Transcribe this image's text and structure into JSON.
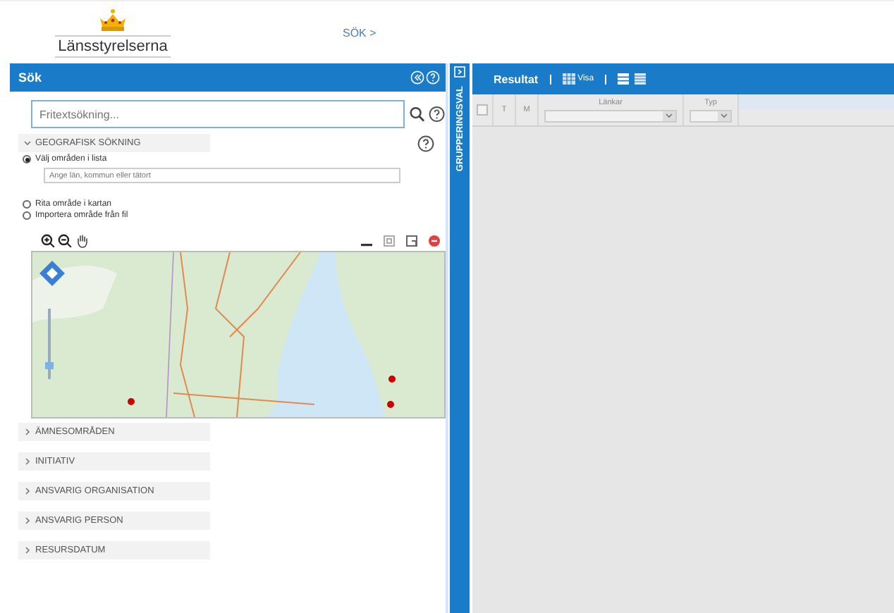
{
  "header": {
    "logo_text": "Länsstyrelserna",
    "nav_link": "SÖK >"
  },
  "search_panel": {
    "title": "Sök",
    "search_field": {
      "placeholder": "Fritextsökning..."
    },
    "geo_section": {
      "title": "GEOGRAFISK SÖKNING",
      "expanded": true,
      "options": [
        {
          "label": "Välj områden i lista",
          "selected": true,
          "field_placeholder": "Ange län, kommun eller tätort"
        },
        {
          "label": "Rita område i kartan",
          "selected": false
        },
        {
          "label": "Importera område från fil",
          "selected": false
        }
      ]
    },
    "sections": [
      {
        "title": "ÄMNESOMRÅDEN",
        "expanded": false
      },
      {
        "title": "INITIATIV",
        "expanded": false
      },
      {
        "title": "ANSVARIG ORGANISATION",
        "expanded": false
      },
      {
        "title": "ANSVARIG PERSON",
        "expanded": false
      },
      {
        "title": "RESURSDATUM",
        "expanded": false
      }
    ]
  },
  "grouping_tab": {
    "label": "GRUPPERINGSVAL"
  },
  "results": {
    "title": "Resultat",
    "view_menu": "Visa",
    "select_all_checked": false,
    "columns": [
      {
        "label": "T",
        "kind": "plain"
      },
      {
        "label": "M",
        "kind": "plain"
      },
      {
        "label": "Länkar",
        "kind": "filter"
      },
      {
        "label": "Typ",
        "kind": "filter"
      }
    ]
  }
}
